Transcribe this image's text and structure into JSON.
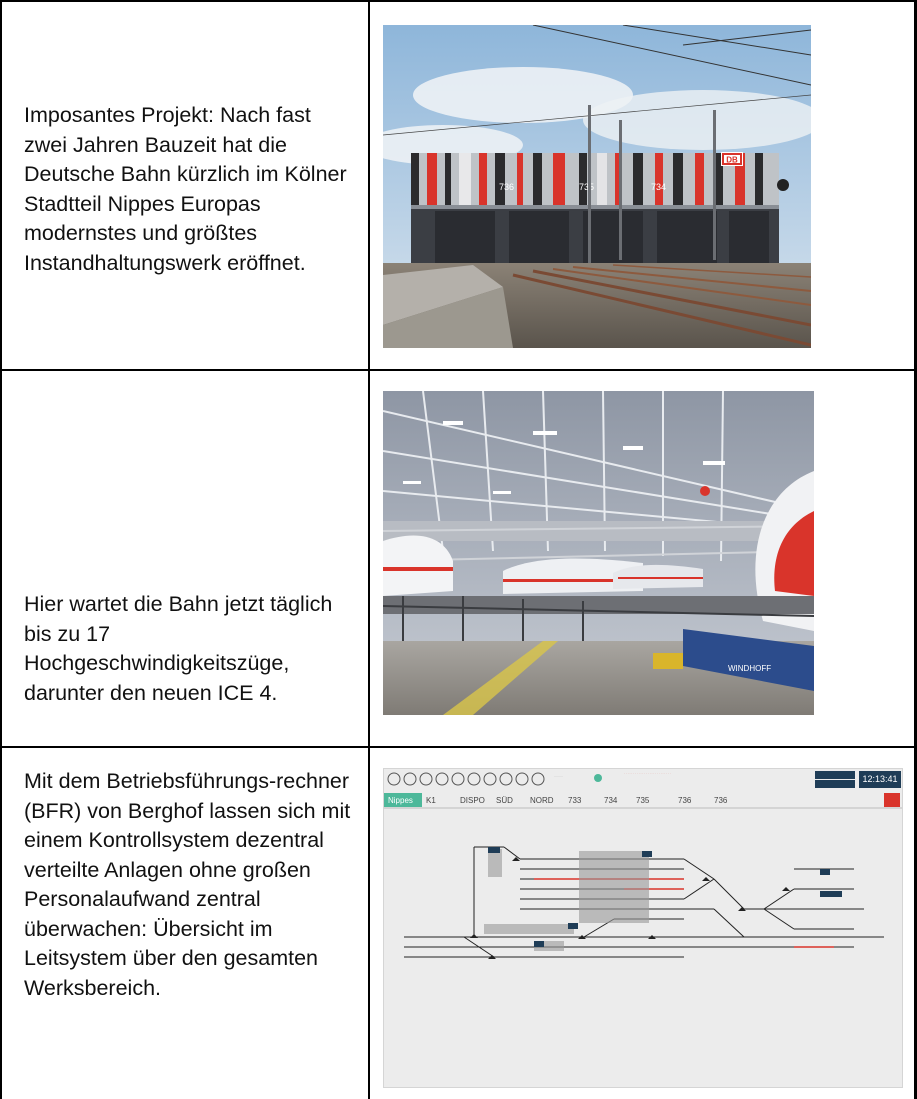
{
  "rows": [
    {
      "text": "Imposantes Projekt: Nach fast zwei Jahren Bauzeit hat die Deutsche Bahn kürzlich im Kölner Stadtteil Nippes Europas modernstes und größtes Instandhaltungswerk eröffnet.",
      "photo": {
        "kind": "depot-exterior-photo",
        "signs": [
          "DB",
          "736",
          "735",
          "734"
        ]
      }
    },
    {
      "text": "Hier wartet die Bahn jetzt täglich bis zu 17 Hochgeschwindigkeitszüge, darunter den neuen ICE 4.",
      "photo": {
        "kind": "ice-trains-in-hall-photo",
        "signs": [
          "WINDHOFF"
        ]
      }
    },
    {
      "text": "Mit dem Betriebsführungs-rechner (BFR) von Berghof lassen sich mit einem Kontrollsystem dezentral verteilte Anlagen ohne großen Personalaufwand zentral überwachen: Übersicht im Leitsystem über den gesamten Werksbereich.",
      "screen": {
        "tabs": [
          "Nippes",
          "K1",
          "DISPO",
          "SÜD",
          "NORD",
          "733",
          "734",
          "735",
          "736",
          "736"
        ],
        "clock": "12:13:41",
        "colors": {
          "tab_active": "#4db89a",
          "alarm": "#d9342b",
          "header_box": "#1f3d57"
        }
      }
    }
  ]
}
